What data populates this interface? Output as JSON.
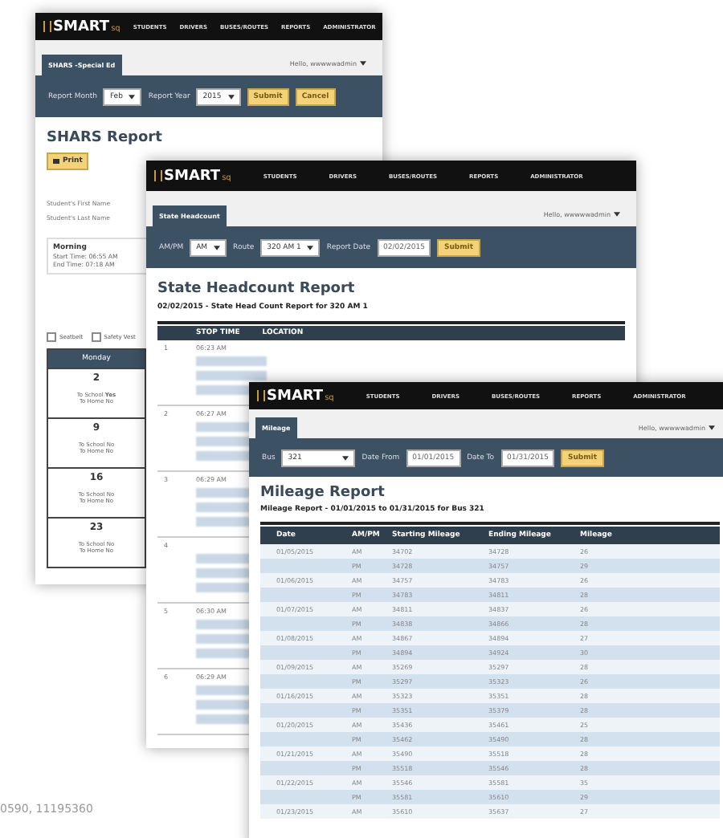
{
  "windows": [
    {
      "kind": "shars",
      "logo": {
        "main": "SMART",
        "sub": "sq"
      },
      "nav_items": [
        "STUDENTS",
        "DRIVERS",
        "BUSES/ROUTES",
        "REPORTS",
        "ADMINISTRATOR"
      ],
      "user_menu": "Hello, wwwwwadmin",
      "tabs": [
        {
          "label": "SHARS -Special Ed",
          "selected": true
        }
      ],
      "filters": [
        {
          "kind": "select",
          "label": "Report Month",
          "value": "Feb"
        },
        {
          "kind": "select",
          "label": "Report Year",
          "value": "2015"
        },
        {
          "kind": "button",
          "label": "Submit"
        },
        {
          "kind": "button",
          "label": "Cancel"
        }
      ],
      "body": [
        {
          "kind": "title",
          "text": "SHARS Report"
        },
        {
          "kind": "print",
          "text": "Print"
        },
        {
          "kind": "text",
          "text": "Student's First Name"
        },
        {
          "kind": "text",
          "text": "Student's Last Name"
        },
        {
          "kind": "session",
          "title": "Morning",
          "lines": [
            "Start Time: 06:55 AM",
            "End Time: 07:18 AM"
          ]
        },
        {
          "kind": "checkboxes",
          "items": [
            {
              "label": "Seatbelt",
              "checked": false
            },
            {
              "label": "Safety Vest",
              "checked": false
            }
          ]
        },
        {
          "kind": "calendar",
          "column": "Monday",
          "cells": [
            {
              "day": "2",
              "lines": [
                "To School **Yes**",
                "To Home No"
              ]
            },
            {
              "day": "9",
              "lines": [
                "To School No",
                "To Home No"
              ]
            },
            {
              "day": "16",
              "lines": [
                "To School No",
                "To Home No"
              ]
            },
            {
              "day": "23",
              "lines": [
                "To School No",
                "To Home No"
              ]
            }
          ]
        }
      ]
    },
    {
      "kind": "headcount",
      "logo": {
        "main": "SMART",
        "sub": "sq"
      },
      "nav_items": [
        "STUDENTS",
        "DRIVERS",
        "BUSES/ROUTES",
        "REPORTS",
        "ADMINISTRATOR"
      ],
      "user_menu": "Hello, wwwwwadmin",
      "tabs": [
        {
          "label": "State Headcount",
          "selected": true
        }
      ],
      "filters": [
        {
          "kind": "select",
          "label": "AM/PM",
          "value": "AM"
        },
        {
          "kind": "select",
          "label": "Route",
          "value": "320 AM 1"
        },
        {
          "kind": "input",
          "label": "Report Date",
          "value": "02/02/2015"
        },
        {
          "kind": "button",
          "label": "Submit"
        }
      ],
      "body": [
        {
          "kind": "title",
          "text": "State Headcount Report"
        },
        {
          "kind": "subtitle",
          "text": "02/02/2015 - State Head Count Report for 320 AM 1"
        },
        {
          "kind": "stops",
          "columns": [
            "STOP TIME",
            "LOCATION"
          ],
          "rows": [
            {
              "number": "1",
              "time": "06:23 AM"
            },
            {
              "number": "2",
              "time": "06:27 AM"
            },
            {
              "number": "3",
              "time": "06:29 AM"
            },
            {
              "number": "4",
              "time": ""
            },
            {
              "number": "5",
              "time": "06:30 AM"
            },
            {
              "number": "6",
              "time": "06:29 AM"
            }
          ]
        }
      ]
    },
    {
      "kind": "mileage",
      "logo": {
        "main": "SMART",
        "sub": "sq"
      },
      "nav_items": [
        "STUDENTS",
        "DRIVERS",
        "BUSES/ROUTES",
        "REPORTS",
        "ADMINISTRATOR"
      ],
      "user_menu": "Hello, wwwwwadmin",
      "tabs": [
        {
          "label": "Mileage",
          "selected": true
        }
      ],
      "filters": [
        {
          "kind": "select",
          "label": "Bus",
          "value": "321"
        },
        {
          "kind": "input",
          "label": "Date From",
          "value": "01/01/2015"
        },
        {
          "kind": "input",
          "label": "Date To",
          "value": "01/31/2015"
        },
        {
          "kind": "button",
          "label": "Submit"
        }
      ],
      "body": [
        {
          "kind": "title",
          "text": "Mileage Report"
        },
        {
          "kind": "subtitle",
          "text": "Mileage Report - 01/01/2015 to 01/31/2015 for Bus 321"
        },
        {
          "kind": "mileage_table",
          "columns": [
            "Date",
            "AM/PM",
            "Starting Mileage",
            "Ending Mileage",
            "Mileage"
          ],
          "rows": [
            [
              "01/05/2015",
              "AM",
              "34702",
              "34728",
              "26"
            ],
            [
              "",
              "PM",
              "34728",
              "34757",
              "29"
            ],
            [
              "01/06/2015",
              "AM",
              "34757",
              "34783",
              "26"
            ],
            [
              "",
              "PM",
              "34783",
              "34811",
              "28"
            ],
            [
              "01/07/2015",
              "AM",
              "34811",
              "34837",
              "26"
            ],
            [
              "",
              "PM",
              "34838",
              "34866",
              "28"
            ],
            [
              "01/08/2015",
              "AM",
              "34867",
              "34894",
              "27"
            ],
            [
              "",
              "PM",
              "34894",
              "34924",
              "30"
            ],
            [
              "01/09/2015",
              "AM",
              "35269",
              "35297",
              "28"
            ],
            [
              "",
              "PM",
              "35297",
              "35323",
              "26"
            ],
            [
              "01/16/2015",
              "AM",
              "35323",
              "35351",
              "28"
            ],
            [
              "",
              "PM",
              "35351",
              "35379",
              "28"
            ],
            [
              "01/20/2015",
              "AM",
              "35436",
              "35461",
              "25"
            ],
            [
              "",
              "PM",
              "35462",
              "35490",
              "28"
            ],
            [
              "01/21/2015",
              "AM",
              "35490",
              "35518",
              "28"
            ],
            [
              "",
              "PM",
              "35518",
              "35546",
              "28"
            ],
            [
              "01/22/2015",
              "AM",
              "35546",
              "35581",
              "35"
            ],
            [
              "",
              "PM",
              "35581",
              "35610",
              "29"
            ],
            [
              "01/23/2015",
              "AM",
              "35610",
              "35637",
              "27"
            ]
          ]
        }
      ]
    }
  ],
  "footer_text": "0590, 11195360"
}
